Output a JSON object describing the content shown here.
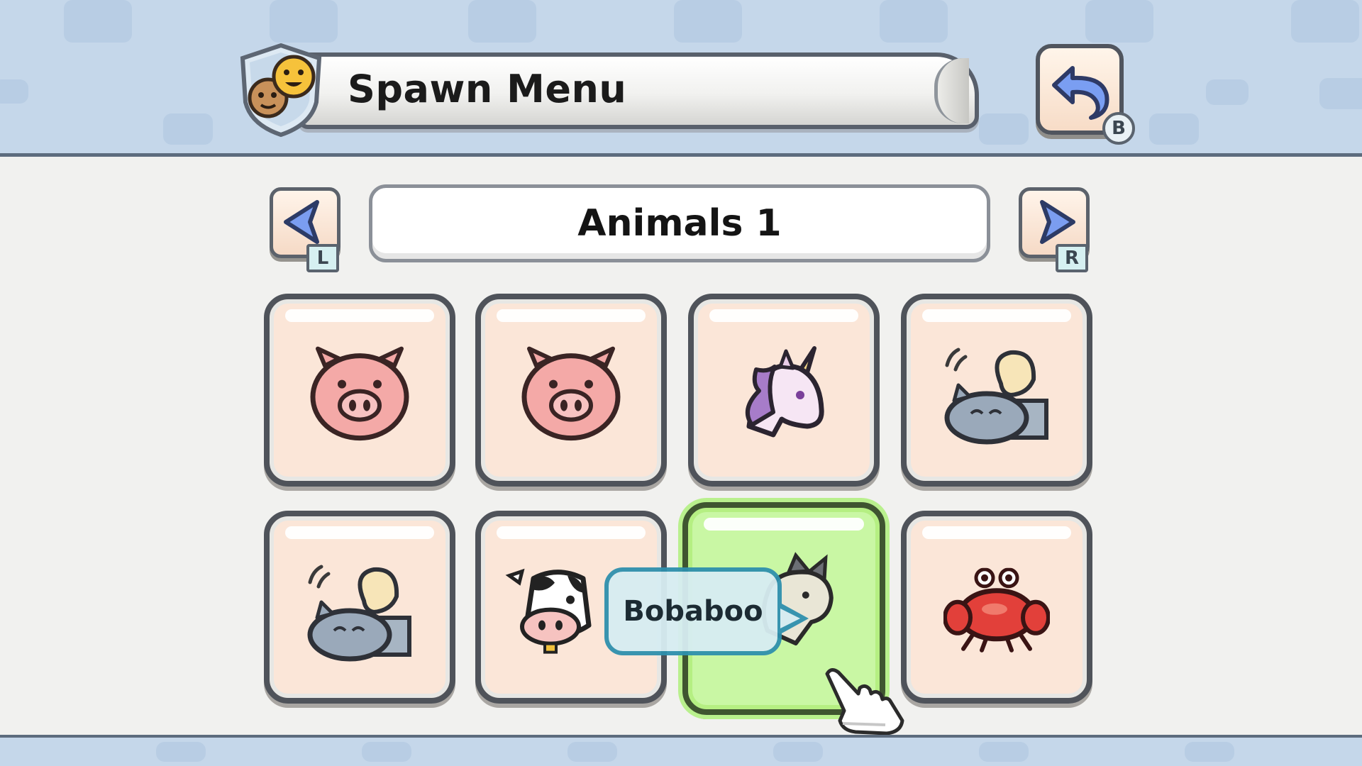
{
  "header": {
    "title": "Spawn Menu",
    "back_key": "B"
  },
  "category": {
    "label": "Animals 1",
    "prev_key": "L",
    "next_key": "R"
  },
  "tooltip": {
    "text": "Bobaboo"
  },
  "grid": {
    "items": [
      {
        "icon": "pig-icon",
        "selected": false
      },
      {
        "icon": "pig-icon",
        "selected": false
      },
      {
        "icon": "unicorn-icon",
        "selected": false
      },
      {
        "icon": "sleeping-creature-icon",
        "selected": false
      },
      {
        "icon": "sleeping-creature-icon",
        "selected": false
      },
      {
        "icon": "cow-icon",
        "selected": false
      },
      {
        "icon": "goat-icon",
        "selected": true
      },
      {
        "icon": "crab-icon",
        "selected": false
      }
    ]
  },
  "colors": {
    "header_band": "#c5d7ea",
    "cell_bg": "#fbe6d8",
    "cell_selected": "#c9f7a4",
    "tooltip_border": "#2f90ad"
  }
}
